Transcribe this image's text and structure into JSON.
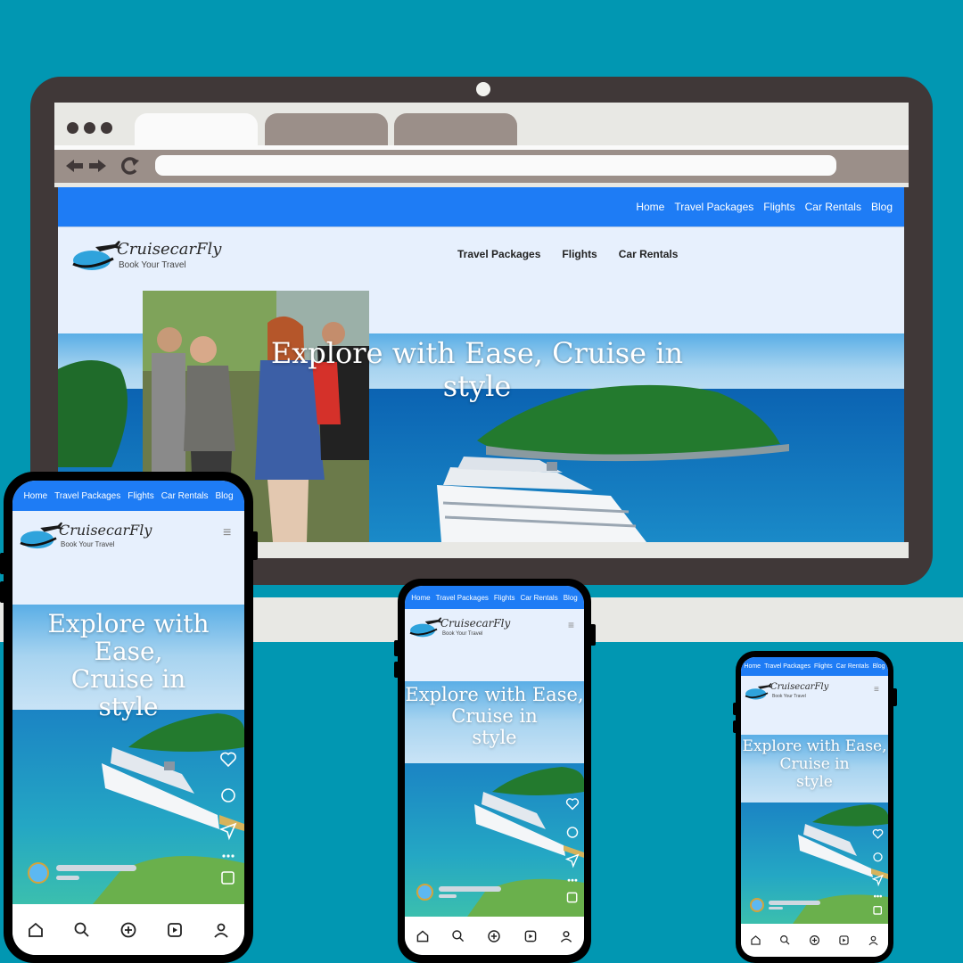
{
  "site": {
    "brand": "CruisecarFly",
    "tagline": "Book Your Travel",
    "top_nav": [
      "Home",
      "Travel Packages",
      "Flights",
      "Car Rentals",
      "Blog"
    ],
    "main_nav": [
      "Travel Packages",
      "Flights",
      "Car Rentals"
    ],
    "hero_title": "Explore with Ease, Cruise in style"
  },
  "browser": {
    "back_icon": "arrow-left-icon",
    "forward_icon": "arrow-right-icon",
    "reload_icon": "reload-icon"
  },
  "mobile": {
    "hero_lines": [
      "Explore with Ease,",
      "Cruise in",
      "style"
    ],
    "side_icons": [
      "heart-icon",
      "comment-icon",
      "send-icon",
      "more-icon",
      "bookmark-icon"
    ],
    "bottom_icons": [
      "home-icon",
      "search-icon",
      "add-icon",
      "reels-icon",
      "profile-icon"
    ]
  },
  "colors": {
    "background": "#0197b2",
    "nav_blue": "#1e7cf5",
    "page_bg": "#e7f0fd",
    "frame": "#403838"
  }
}
